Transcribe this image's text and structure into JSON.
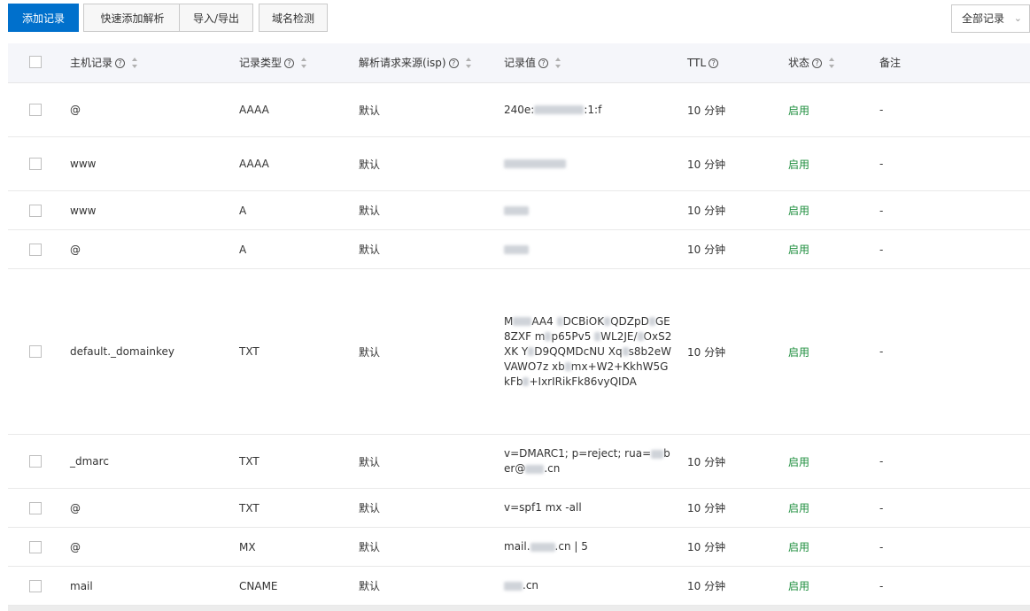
{
  "toolbar": {
    "add_record": "添加记录",
    "quick_add": "快速添加解析",
    "import_export": "导入/导出",
    "domain_check": "域名检测",
    "filter_value": "全部记录"
  },
  "columns": {
    "host": "主机记录",
    "type": "记录类型",
    "isp": "解析请求来源(isp)",
    "value": "记录值",
    "ttl": "TTL",
    "status": "状态",
    "remark": "备注"
  },
  "rows": [
    {
      "host": "@",
      "type": "AAAA",
      "isp": "默认",
      "value": "240e:████████:1:f",
      "ttl": "10 分钟",
      "status": "启用",
      "remark": "-"
    },
    {
      "host": "www",
      "type": "AAAA",
      "isp": "默认",
      "value": "██████████",
      "ttl": "10 分钟",
      "status": "启用",
      "remark": "-"
    },
    {
      "host": "www",
      "type": "A",
      "isp": "默认",
      "value": "████",
      "ttl": "10 分钟",
      "status": "启用",
      "remark": "-"
    },
    {
      "host": "@",
      "type": "A",
      "isp": "默认",
      "value": "████",
      "ttl": "10 分钟",
      "status": "启用",
      "remark": "-"
    },
    {
      "host": "default._domainkey",
      "type": "TXT",
      "isp": "默认",
      "value": "M███AA4 █DCBiOK█QDZpD█GE8ZXF m█p65Pv5 █WL2JE/█OxS2XK Y█D9QQMDcNU Xq█s8b2eWVAWO7z xb█mx+W2+KkhW5G kFb█+IxrIRikFk86vyQIDA",
      "ttl": "10 分钟",
      "status": "启用",
      "remark": "-"
    },
    {
      "host": "_dmarc",
      "type": "TXT",
      "isp": "默认",
      "value": "v=DMARC1; p=reject; rua=██b er@███.cn",
      "ttl": "10 分钟",
      "status": "启用",
      "remark": "-"
    },
    {
      "host": "@",
      "type": "TXT",
      "isp": "默认",
      "value": "v=spf1 mx -all",
      "ttl": "10 分钟",
      "status": "启用",
      "remark": "-"
    },
    {
      "host": "@",
      "type": "MX",
      "isp": "默认",
      "value": "mail.████.cn | 5",
      "ttl": "10 分钟",
      "status": "启用",
      "remark": "-"
    },
    {
      "host": "mail",
      "type": "CNAME",
      "isp": "默认",
      "value": "███.cn",
      "ttl": "10 分钟",
      "status": "启用",
      "remark": "-"
    }
  ]
}
